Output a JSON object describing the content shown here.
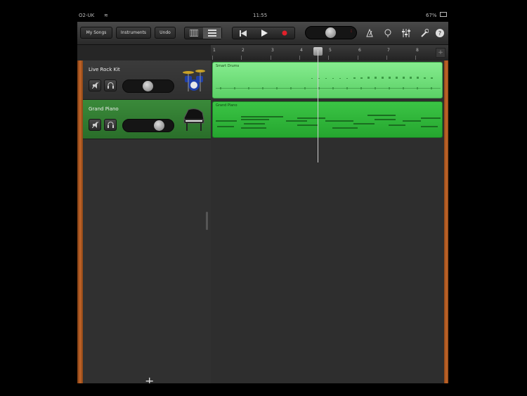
{
  "status_bar": {
    "carrier": "O2-UK",
    "time": "11:55",
    "battery": "67%"
  },
  "toolbar": {
    "my_songs_label": "My Songs",
    "instruments_label": "Instruments",
    "undo_label": "Undo"
  },
  "ruler": {
    "bars": [
      "1",
      "2",
      "3",
      "4",
      "5",
      "6",
      "7",
      "8"
    ]
  },
  "tracks": [
    {
      "name": "Live Rock Kit",
      "region_label": "Smart Drums",
      "volume": 0.45,
      "selected": false,
      "icon": "drum-kit-icon"
    },
    {
      "name": "Grand Piano",
      "region_label": "Grand Piano",
      "volume": 0.7,
      "selected": true,
      "icon": "grand-piano-icon"
    }
  ],
  "add_track_label": "+",
  "colors": {
    "region_light_green": "#6fe07a",
    "region_dark_green": "#31b63a",
    "selected_header": "#2f7a2f",
    "record_red": "#e0202a",
    "wood": "#c4662a"
  }
}
